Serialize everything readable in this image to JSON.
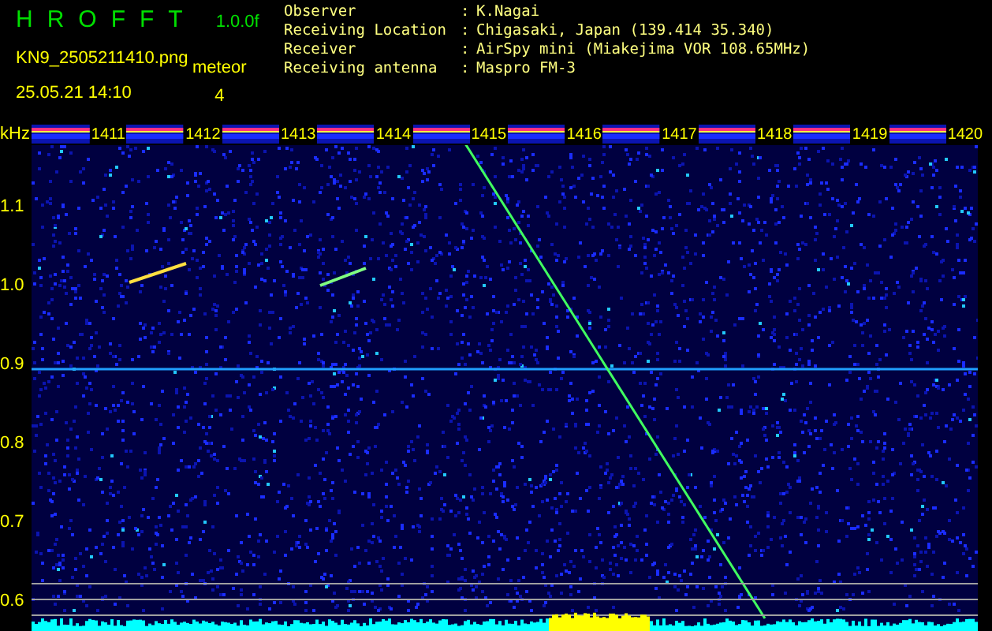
{
  "header": {
    "title": "HROFFT",
    "version": "1.0.0f",
    "filename": "KN9_2505211410.png",
    "datetime": "25.05.21 14:10",
    "meteor_label": "meteor",
    "meteor_count": "4"
  },
  "info": [
    {
      "label": "Observer",
      "separator": ":",
      "value": "K.Nagai"
    },
    {
      "label": "Receiving Location",
      "separator": ":",
      "value": "Chigasaki, Japan (139.414 35.340)"
    },
    {
      "label": "Receiver",
      "separator": ":",
      "value": "AirSpy mini (Miakejima VOR 108.65MHz)"
    },
    {
      "label": "Receiving antenna",
      "separator": ":",
      "value": "Maspro FM-3"
    }
  ],
  "spectrogram": {
    "unit": "kHz",
    "time_labels": [
      "1411",
      "1412",
      "1413",
      "1414",
      "1415",
      "1416",
      "1417",
      "1418",
      "1419",
      "1420"
    ],
    "freq_labels": [
      "1.1",
      "1.0",
      "0.9",
      "0.8",
      "0.7",
      "0.6"
    ]
  }
}
